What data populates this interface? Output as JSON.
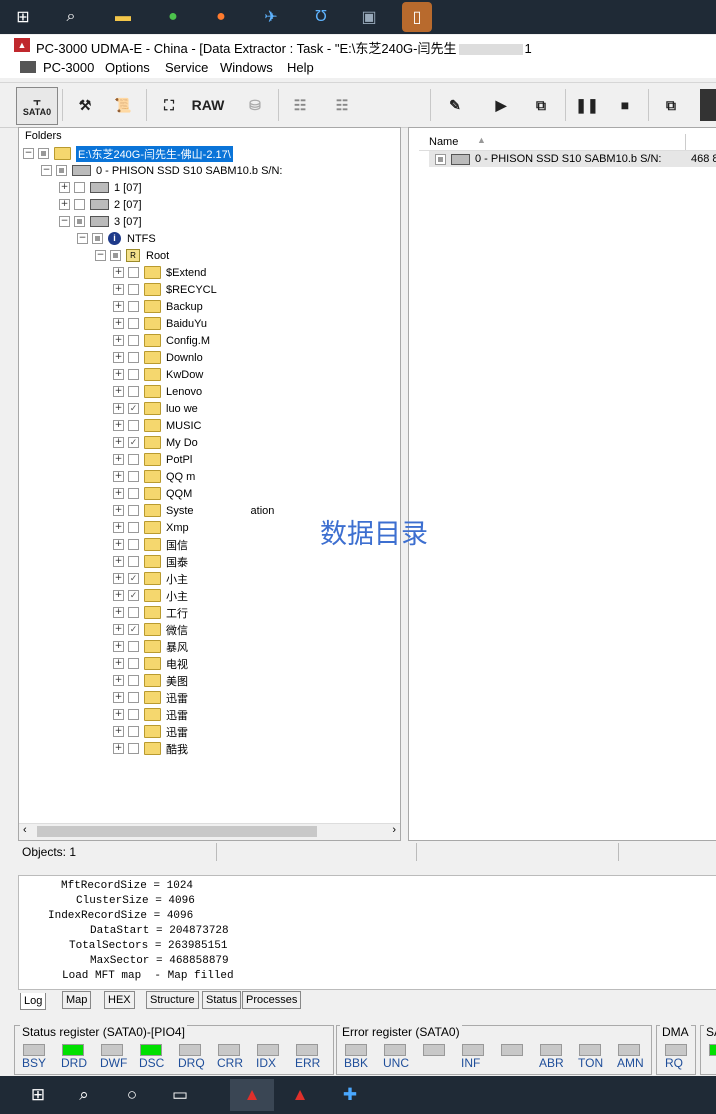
{
  "window": {
    "title": "PC-3000 UDMA-E - China - [Data Extractor : Task - \"E:\\东芝240G-闫先生",
    "title_suffix": "1"
  },
  "menu": [
    "PC-3000",
    "Options",
    "Service",
    "Windows",
    "Help"
  ],
  "toolbar": {
    "sata_label": "SATA0",
    "raw_label": "RAW"
  },
  "folders": {
    "label": "Folders",
    "root": "E:\\东芝240G-闫先生-佛山-2.17\\",
    "drive": "0 - PHISON SSD S10 SABM10.b S/N:",
    "partitions": [
      "1 [07]",
      "2 [07]",
      "3 [07]"
    ],
    "fs": "NTFS",
    "root_dir": "Root",
    "items": [
      {
        "name": "$Extend",
        "checked": false
      },
      {
        "name": "$RECYCL",
        "checked": false
      },
      {
        "name": "Backup",
        "checked": false
      },
      {
        "name": "BaiduYu",
        "checked": false
      },
      {
        "name": "Config.M",
        "checked": false
      },
      {
        "name": "Downlo",
        "checked": false
      },
      {
        "name": "KwDow",
        "checked": false
      },
      {
        "name": "Lenovo",
        "checked": false
      },
      {
        "name": "luo we",
        "checked": true
      },
      {
        "name": "MUSIC",
        "checked": false
      },
      {
        "name": "My Do",
        "checked": true
      },
      {
        "name": "PotPl",
        "checked": false
      },
      {
        "name": "QQ m",
        "checked": false
      },
      {
        "name": "QQM",
        "checked": false
      },
      {
        "name": "Syste",
        "checked": false
      },
      {
        "name": "Xmp",
        "checked": false
      },
      {
        "name": "国信",
        "checked": false
      },
      {
        "name": "国泰",
        "checked": false
      },
      {
        "name": "小主",
        "checked": true
      },
      {
        "name": "小主",
        "checked": true
      },
      {
        "name": "工行",
        "checked": false
      },
      {
        "name": "微信",
        "checked": true
      },
      {
        "name": "暴风",
        "checked": false
      },
      {
        "name": "电视",
        "checked": false
      },
      {
        "name": "美图",
        "checked": false
      },
      {
        "name": "迅雷",
        "checked": false
      },
      {
        "name": "迅雷",
        "checked": false
      },
      {
        "name": "迅雷",
        "checked": false
      },
      {
        "name": "酷我",
        "checked": false
      }
    ],
    "system_suffix": "ation"
  },
  "list": {
    "col_name": "Name",
    "row": "0 - PHISON SSD S10 SABM10.b S/N:",
    "row_size": "468 8"
  },
  "status": {
    "objects": "Objects: 1"
  },
  "log": [
    "MftRecordSize = 1024",
    "ClusterSize = 4096",
    "IndexRecordSize = 4096",
    "DataStart = 204873728",
    "TotalSectors = 263985151",
    "MaxSector = 468858879",
    "Load MFT map  - Map filled"
  ],
  "log_tabs": [
    "Log",
    "Map",
    "HEX",
    "Structure",
    "Status",
    "Processes"
  ],
  "status_register": {
    "title": "Status register (SATA0)-[PIO4]",
    "bits": [
      {
        "label": "BSY",
        "on": false
      },
      {
        "label": "DRD",
        "on": true
      },
      {
        "label": "DWF",
        "on": false
      },
      {
        "label": "DSC",
        "on": true
      },
      {
        "label": "DRQ",
        "on": false
      },
      {
        "label": "CRR",
        "on": false
      },
      {
        "label": "IDX",
        "on": false
      },
      {
        "label": "ERR",
        "on": false
      }
    ]
  },
  "error_register": {
    "title": "Error register (SATA0)",
    "bits": [
      "BBK",
      "UNC",
      "",
      "INF",
      "",
      "ABR",
      "TON",
      "AMN"
    ]
  },
  "dma": {
    "title": "DMA",
    "bit": "RQ"
  },
  "sa": {
    "title": "SA"
  },
  "overlay_text": "数据目录",
  "colors": {
    "selection": "#0a74d8",
    "led_on": "#00e000",
    "overlay": "#3d6fd0"
  }
}
